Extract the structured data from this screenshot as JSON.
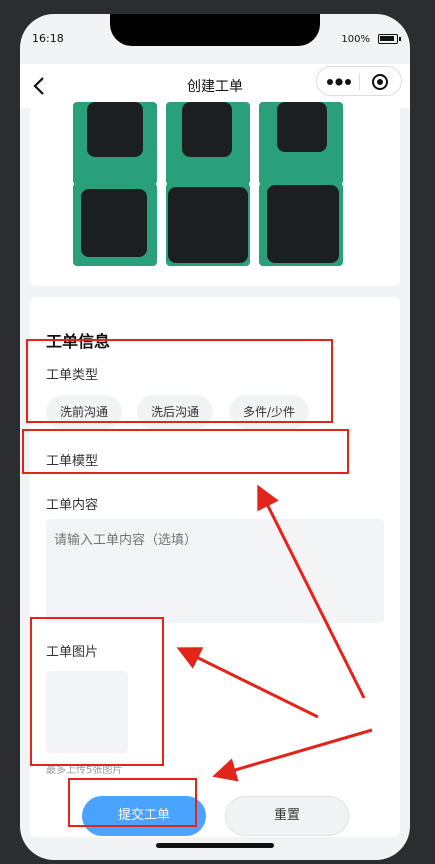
{
  "status": {
    "time": "16:18",
    "battery": "100%"
  },
  "nav": {
    "title": "创建工单"
  },
  "photos": [
    {
      "name": "photo-1"
    },
    {
      "name": "photo-2"
    },
    {
      "name": "photo-3"
    },
    {
      "name": "photo-4"
    },
    {
      "name": "photo-5"
    },
    {
      "name": "photo-6"
    }
  ],
  "info": {
    "title": "工单信息",
    "type_label": "工单类型",
    "type_options": [
      "洗前沟通",
      "洗后沟通",
      "多件/少件"
    ],
    "model_label": "工单模型",
    "content_label": "工单内容",
    "content_placeholder": "请输入工单内容（选填）",
    "image_label": "工单图片",
    "image_hint": "最多上传5张图片",
    "submit_label": "提交工单",
    "reset_label": "重置"
  },
  "colors": {
    "accent": "#4aa3ff",
    "annotation": "#e3241b"
  }
}
